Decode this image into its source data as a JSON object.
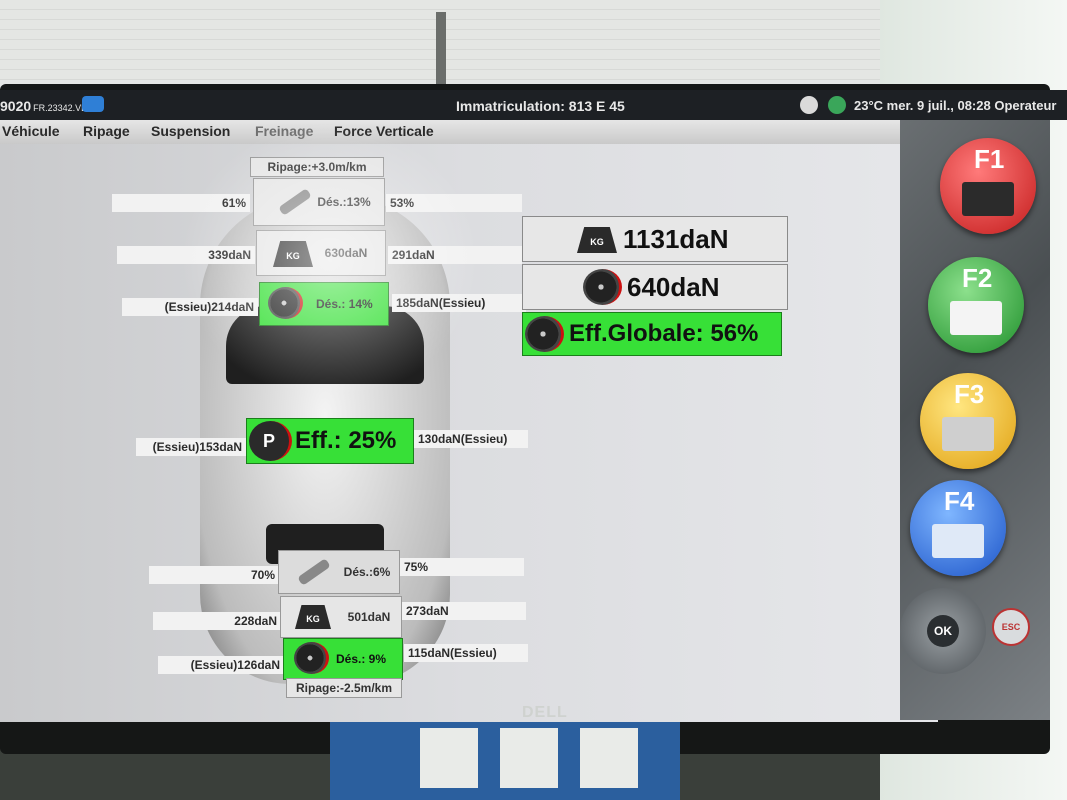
{
  "titlebar": {
    "app_id": "9020",
    "app_id_small": "FR.23342.VL",
    "title": "Immatriculation: 813 E 45",
    "status": "23°C mer. 9 juil., 08:28 Operateur"
  },
  "menu": {
    "items": [
      "Véhicule",
      "Ripage",
      "Suspension",
      "Freinage",
      "Force Verticale"
    ]
  },
  "front": {
    "ripage": "Ripage:+3.0m/km",
    "susp_left": "61%",
    "susp_right": "53%",
    "susp_des": "Dés.:13%",
    "weight_left": "339daN",
    "weight_right": "291daN",
    "weight_total": "630daN",
    "brake_left": "(Essieu)214daN",
    "brake_right": "185daN(Essieu)",
    "brake_des": "Dés.: 14%"
  },
  "parking": {
    "left": "(Essieu)153daN",
    "right": "130daN(Essieu)",
    "eff": "Eff.: 25%",
    "icon_label": "P"
  },
  "rear": {
    "susp_left": "70%",
    "susp_right": "75%",
    "susp_des": "Dés.:6%",
    "weight_left": "228daN",
    "weight_right": "273daN",
    "weight_total": "501daN",
    "brake_left": "(Essieu)126daN",
    "brake_right": "115daN(Essieu)",
    "brake_des": "Dés.: 9%",
    "ripage": "Ripage:-2.5m/km"
  },
  "summary": {
    "total_weight": "1131daN",
    "total_brake": "640daN",
    "efficiency": "Eff.Globale: 56%"
  },
  "icons": {
    "kg_label": "KG"
  },
  "fkeys": [
    "F1",
    "F2",
    "F3",
    "F4"
  ],
  "nav": {
    "ok": "OK",
    "esc": "ESC"
  },
  "bezel_brand": "DELL",
  "colors": {
    "ok_green": "#37e037",
    "brake_red": "#cc1111"
  }
}
